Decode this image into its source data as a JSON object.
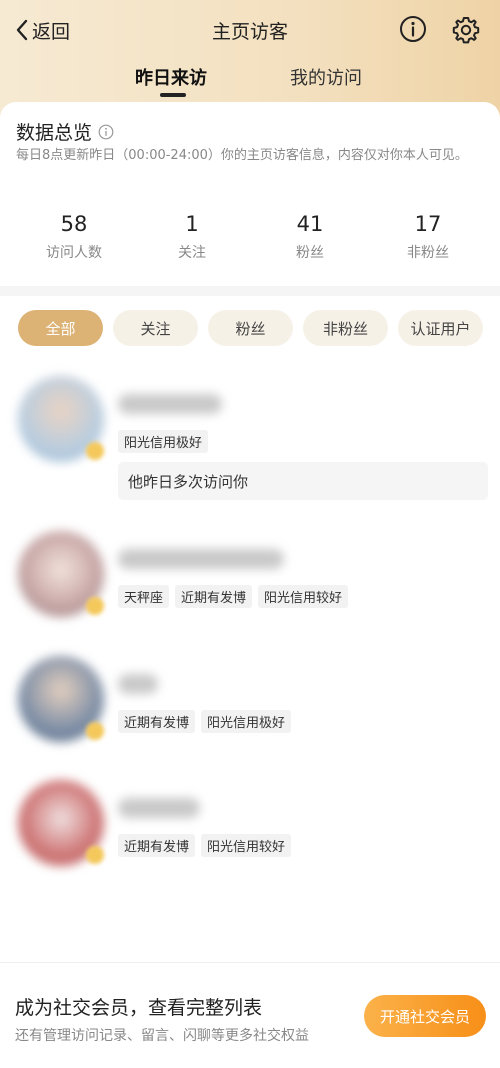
{
  "header": {
    "back_label": "返回",
    "title": "主页访客",
    "info_icon": "info-circle-icon",
    "settings_icon": "gear-icon"
  },
  "tabs": [
    {
      "label": "昨日来访",
      "active": true
    },
    {
      "label": "我的访问",
      "active": false
    }
  ],
  "overview": {
    "title": "数据总览",
    "description": "每日8点更新昨日（00:00-24:00）你的主页访客信息，内容仅对你本人可见。"
  },
  "stats": [
    {
      "value": "58",
      "label": "访问人数"
    },
    {
      "value": "1",
      "label": "关注"
    },
    {
      "value": "41",
      "label": "粉丝"
    },
    {
      "value": "17",
      "label": "非粉丝"
    }
  ],
  "filters": [
    {
      "label": "全部",
      "active": true
    },
    {
      "label": "关注",
      "active": false
    },
    {
      "label": "粉丝",
      "active": false
    },
    {
      "label": "非粉丝",
      "active": false
    },
    {
      "label": "认证用户",
      "active": false
    }
  ],
  "visitors": [
    {
      "tags": [
        "阳光信用极好"
      ],
      "note": "他昨日多次访问你"
    },
    {
      "tags": [
        "天秤座",
        "近期有发博",
        "阳光信用较好"
      ],
      "note": null
    },
    {
      "tags": [
        "近期有发博",
        "阳光信用极好"
      ],
      "note": null
    },
    {
      "tags": [
        "近期有发博",
        "阳光信用较好"
      ],
      "note": null
    }
  ],
  "promo": {
    "title": "成为社交会员，查看完整列表",
    "subtitle": "还有管理访问记录、留言、闪聊等更多社交权益",
    "button_label": "开通社交会员"
  },
  "colors": {
    "accent_chip": "#dcb275",
    "vip_button": "#f78f18",
    "header_gradient_start": "#f6ead3",
    "header_gradient_end": "#efd3a6"
  }
}
